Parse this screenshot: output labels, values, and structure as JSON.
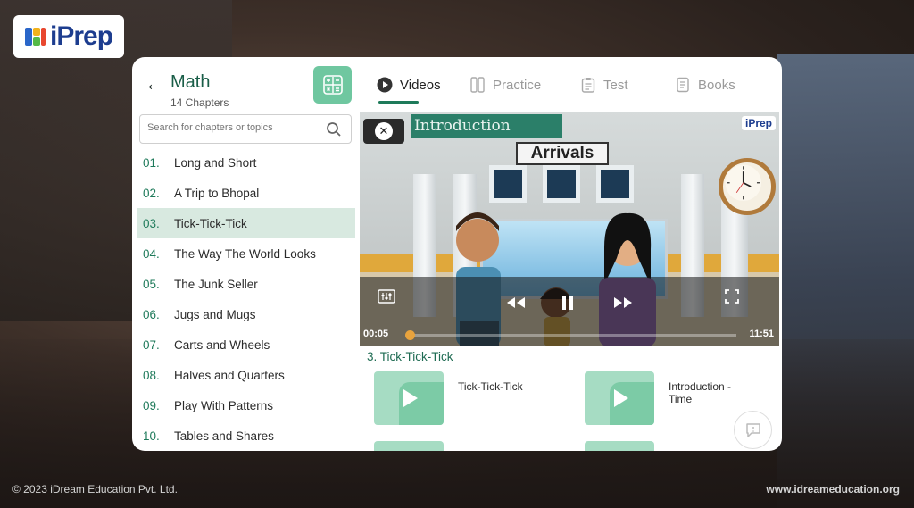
{
  "brand": {
    "logo_text": "iPrep"
  },
  "header": {
    "subject": "Math",
    "chapter_count": "14 Chapters"
  },
  "search": {
    "placeholder": "Search for chapters or topics"
  },
  "tabs": [
    {
      "label": "Videos",
      "icon": "play-circle-icon",
      "active": true
    },
    {
      "label": "Practice",
      "icon": "practice-icon",
      "active": false
    },
    {
      "label": "Test",
      "icon": "clipboard-icon",
      "active": false
    },
    {
      "label": "Books",
      "icon": "book-icon",
      "active": false
    }
  ],
  "chapters": [
    {
      "num": "01.",
      "title": "Long and Short"
    },
    {
      "num": "02.",
      "title": "A Trip to Bhopal"
    },
    {
      "num": "03.",
      "title": "Tick-Tick-Tick",
      "active": true
    },
    {
      "num": "04.",
      "title": "The Way The World Looks"
    },
    {
      "num": "05.",
      "title": "The Junk Seller"
    },
    {
      "num": "06.",
      "title": "Jugs and Mugs"
    },
    {
      "num": "07.",
      "title": "Carts and Wheels"
    },
    {
      "num": "08.",
      "title": "Halves and Quarters"
    },
    {
      "num": "09.",
      "title": "Play With Patterns"
    },
    {
      "num": "10.",
      "title": "Tables and Shares"
    }
  ],
  "player": {
    "banner": "Introduction",
    "sign": "Arrivals",
    "watermark": "iPrep",
    "current_time": "00:05",
    "total_time": "11:51",
    "progress": 0.01
  },
  "section": {
    "title": "3. Tick-Tick-Tick"
  },
  "videos": [
    {
      "title": "Tick-Tick-Tick"
    },
    {
      "title": "Introduction - Time"
    }
  ],
  "footer": {
    "copyright": "© 2023 iDream Education Pvt. Ltd.",
    "website": "www.idreameducation.org"
  },
  "colors": {
    "accent": "#1e7a5a",
    "active_row": "#d8e9e0",
    "grid_button": "#6fc7a0",
    "progress": "#e0a83b"
  }
}
